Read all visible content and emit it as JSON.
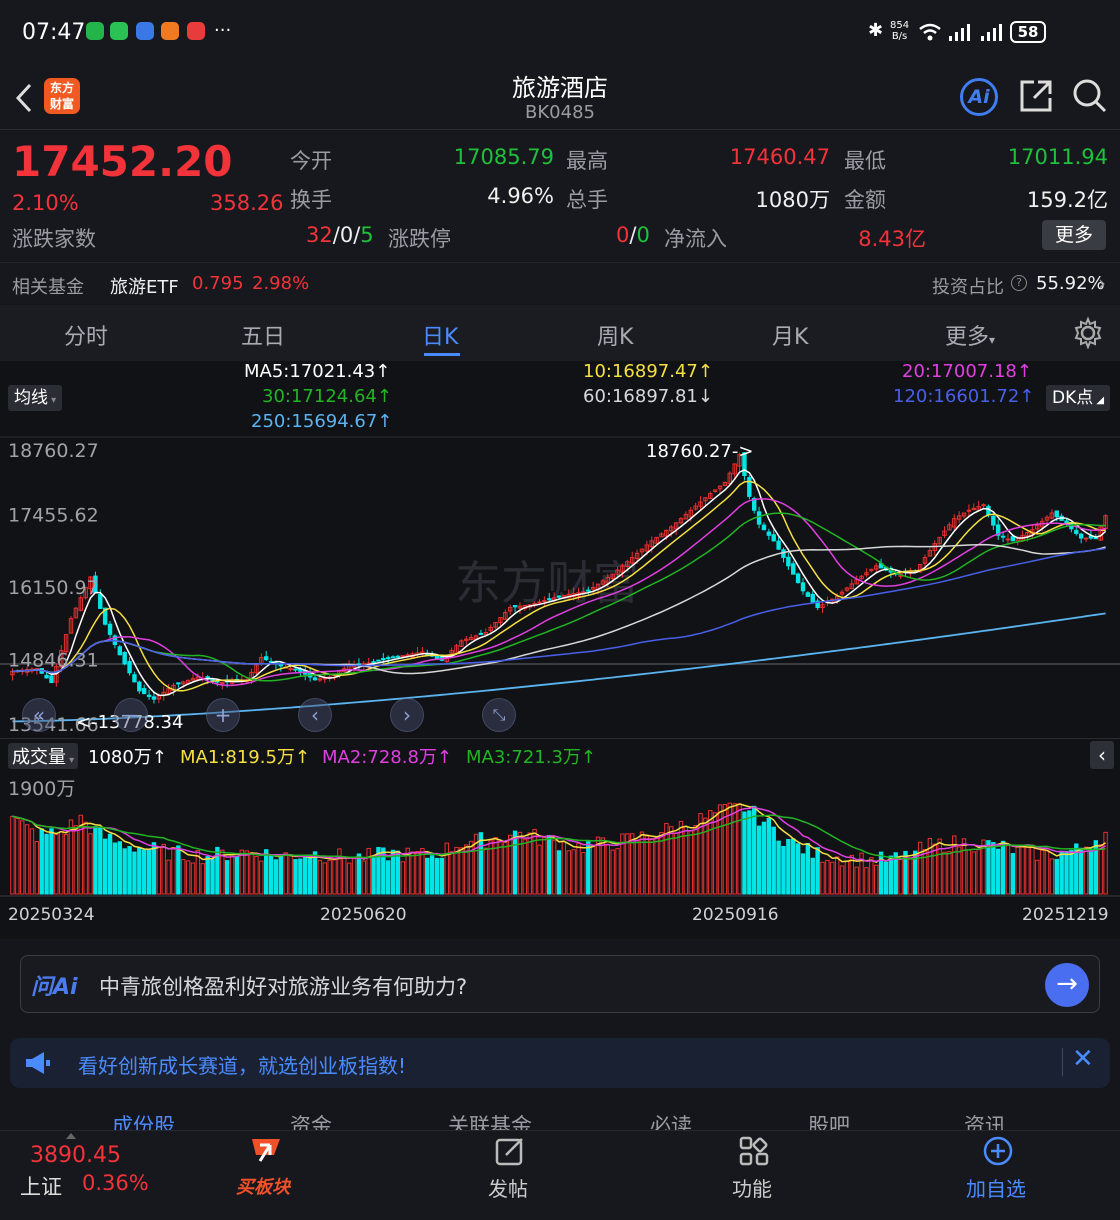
{
  "status": {
    "time": "07:47",
    "more": "···",
    "net_speed_top": "854",
    "net_speed_bottom": "B/s",
    "battery": "58"
  },
  "header": {
    "title": "旅游酒店",
    "code": "BK0485",
    "logo_top": "东方",
    "logo_bottom": "财富",
    "ai_label": "Ai"
  },
  "quote": {
    "price": "17452.20",
    "change_pct": "2.10%",
    "change": "358.26",
    "open_label": "今开",
    "open": "17085.79",
    "high_label": "最高",
    "high": "17460.47",
    "low_label": "最低",
    "low": "17011.94",
    "turnover_label": "换手",
    "turnover": "4.96%",
    "volume_label": "总手",
    "volume": "1080万",
    "amount_label": "金额",
    "amount": "159.2亿",
    "updown_label": "涨跌家数",
    "up_count": "32",
    "sep": "/",
    "flat_count": "0",
    "down_count": "5",
    "limit_label": "涨跌停",
    "limit_up": "0",
    "limit_down": "0",
    "netflow_label": "净流入",
    "netflow": "8.43亿",
    "more_btn": "更多"
  },
  "fund": {
    "label": "相关基金",
    "name": "旅游ETF",
    "price": "0.795",
    "pct": "2.98%",
    "ratio_label": "投资占比",
    "ratio": "55.92%"
  },
  "tabs": [
    "分时",
    "五日",
    "日K",
    "周K",
    "月K",
    "更多"
  ],
  "active_tab": "日K",
  "ma": {
    "button": "均线",
    "dk_button": "DK点",
    "ma5": "MA5:17021.43↑",
    "ma10": "10:16897.47↑",
    "ma20": "20:17007.18↑",
    "ma30": "30:17124.64↑",
    "ma60": "60:16897.81↓",
    "ma120": "120:16601.72↑",
    "ma250": "250:15694.67↑"
  },
  "colors": {
    "ma5": "#ffffff",
    "ma10": "#f5e042",
    "ma20": "#e040e0",
    "ma30": "#22b422",
    "ma60": "#d8d8d8",
    "ma120": "#4860e8",
    "ma250": "#5ab4f0",
    "up": "#e8302f",
    "down": "#00e5e5"
  },
  "chart_data": {
    "type": "candlestick",
    "y_ticks": [
      "18760.27",
      "17455.62",
      "16150.97",
      "14846.31",
      "13541.66"
    ],
    "ylim": [
      13541.66,
      18760.27
    ],
    "high_marker": "18760.27->",
    "low_marker": "<-13778.34",
    "volume_label": "成交量",
    "volume": "1080万↑",
    "vol_ma1": "MA1:819.5万↑",
    "vol_ma2": "MA2:728.8万↑",
    "vol_ma3": "MA3:721.3万↑",
    "vol_max": "1900万",
    "x_ticks": [
      "20250324",
      "20250620",
      "20250916",
      "20251219"
    ],
    "anchors": [
      [
        0,
        14650
      ],
      [
        5,
        14700
      ],
      [
        8,
        14450
      ],
      [
        12,
        15600
      ],
      [
        16,
        16350
      ],
      [
        19,
        15500
      ],
      [
        22,
        14950
      ],
      [
        26,
        14300
      ],
      [
        29,
        14150
      ],
      [
        33,
        14400
      ],
      [
        38,
        14550
      ],
      [
        43,
        14450
      ],
      [
        48,
        14500
      ],
      [
        51,
        14900
      ],
      [
        55,
        14750
      ],
      [
        59,
        14650
      ],
      [
        62,
        14500
      ],
      [
        65,
        14550
      ],
      [
        69,
        14750
      ],
      [
        73,
        14800
      ],
      [
        78,
        14900
      ],
      [
        84,
        15000
      ],
      [
        88,
        14850
      ],
      [
        92,
        15200
      ],
      [
        97,
        15350
      ],
      [
        102,
        15800
      ],
      [
        106,
        15850
      ],
      [
        112,
        16000
      ],
      [
        118,
        16100
      ],
      [
        123,
        16400
      ],
      [
        127,
        16700
      ],
      [
        131,
        17000
      ],
      [
        135,
        17250
      ],
      [
        139,
        17550
      ],
      [
        143,
        17850
      ],
      [
        146,
        18050
      ],
      [
        149,
        18550
      ],
      [
        151,
        17800
      ],
      [
        153,
        17300
      ],
      [
        156,
        17000
      ],
      [
        159,
        16550
      ],
      [
        162,
        16100
      ],
      [
        165,
        15800
      ],
      [
        169,
        16000
      ],
      [
        173,
        16300
      ],
      [
        177,
        16550
      ],
      [
        181,
        16400
      ],
      [
        185,
        16450
      ],
      [
        189,
        16950
      ],
      [
        193,
        17400
      ],
      [
        196,
        17550
      ],
      [
        199,
        17650
      ],
      [
        202,
        17100
      ],
      [
        205,
        17000
      ],
      [
        209,
        17200
      ],
      [
        213,
        17500
      ],
      [
        216,
        17300
      ],
      [
        219,
        17050
      ],
      [
        222,
        17050
      ],
      [
        224,
        17452
      ]
    ],
    "vol_anchors": [
      [
        0,
        1350
      ],
      [
        5,
        1050
      ],
      [
        10,
        1100
      ],
      [
        14,
        1350
      ],
      [
        18,
        1050
      ],
      [
        22,
        900
      ],
      [
        28,
        800
      ],
      [
        34,
        720
      ],
      [
        40,
        680
      ],
      [
        48,
        760
      ],
      [
        55,
        680
      ],
      [
        62,
        720
      ],
      [
        70,
        640
      ],
      [
        78,
        720
      ],
      [
        86,
        680
      ],
      [
        92,
        920
      ],
      [
        98,
        980
      ],
      [
        104,
        1100
      ],
      [
        110,
        950
      ],
      [
        116,
        850
      ],
      [
        122,
        900
      ],
      [
        128,
        1000
      ],
      [
        134,
        1150
      ],
      [
        140,
        1300
      ],
      [
        146,
        1500
      ],
      [
        150,
        1550
      ],
      [
        154,
        1300
      ],
      [
        158,
        1000
      ],
      [
        164,
        720
      ],
      [
        170,
        650
      ],
      [
        176,
        600
      ],
      [
        182,
        620
      ],
      [
        188,
        860
      ],
      [
        194,
        920
      ],
      [
        200,
        880
      ],
      [
        206,
        780
      ],
      [
        212,
        700
      ],
      [
        218,
        780
      ],
      [
        224,
        1080
      ]
    ],
    "ma250_range": [
      13750,
      15694.67
    ]
  },
  "ai": {
    "label": "问Ai",
    "question": "中青旅创格盈利好对旅游业务有何助力?"
  },
  "banner": {
    "text": "看好创新成长赛道，就选创业板指数!"
  },
  "subtabs": [
    "成份股",
    "资金",
    "关联基金",
    "必读",
    "股吧",
    "资讯"
  ],
  "bottom": {
    "index_value": "3890.45",
    "index_name": "上证",
    "index_pct": "0.36%",
    "nav": [
      "买板块",
      "发帖",
      "功能",
      "加自选"
    ]
  }
}
